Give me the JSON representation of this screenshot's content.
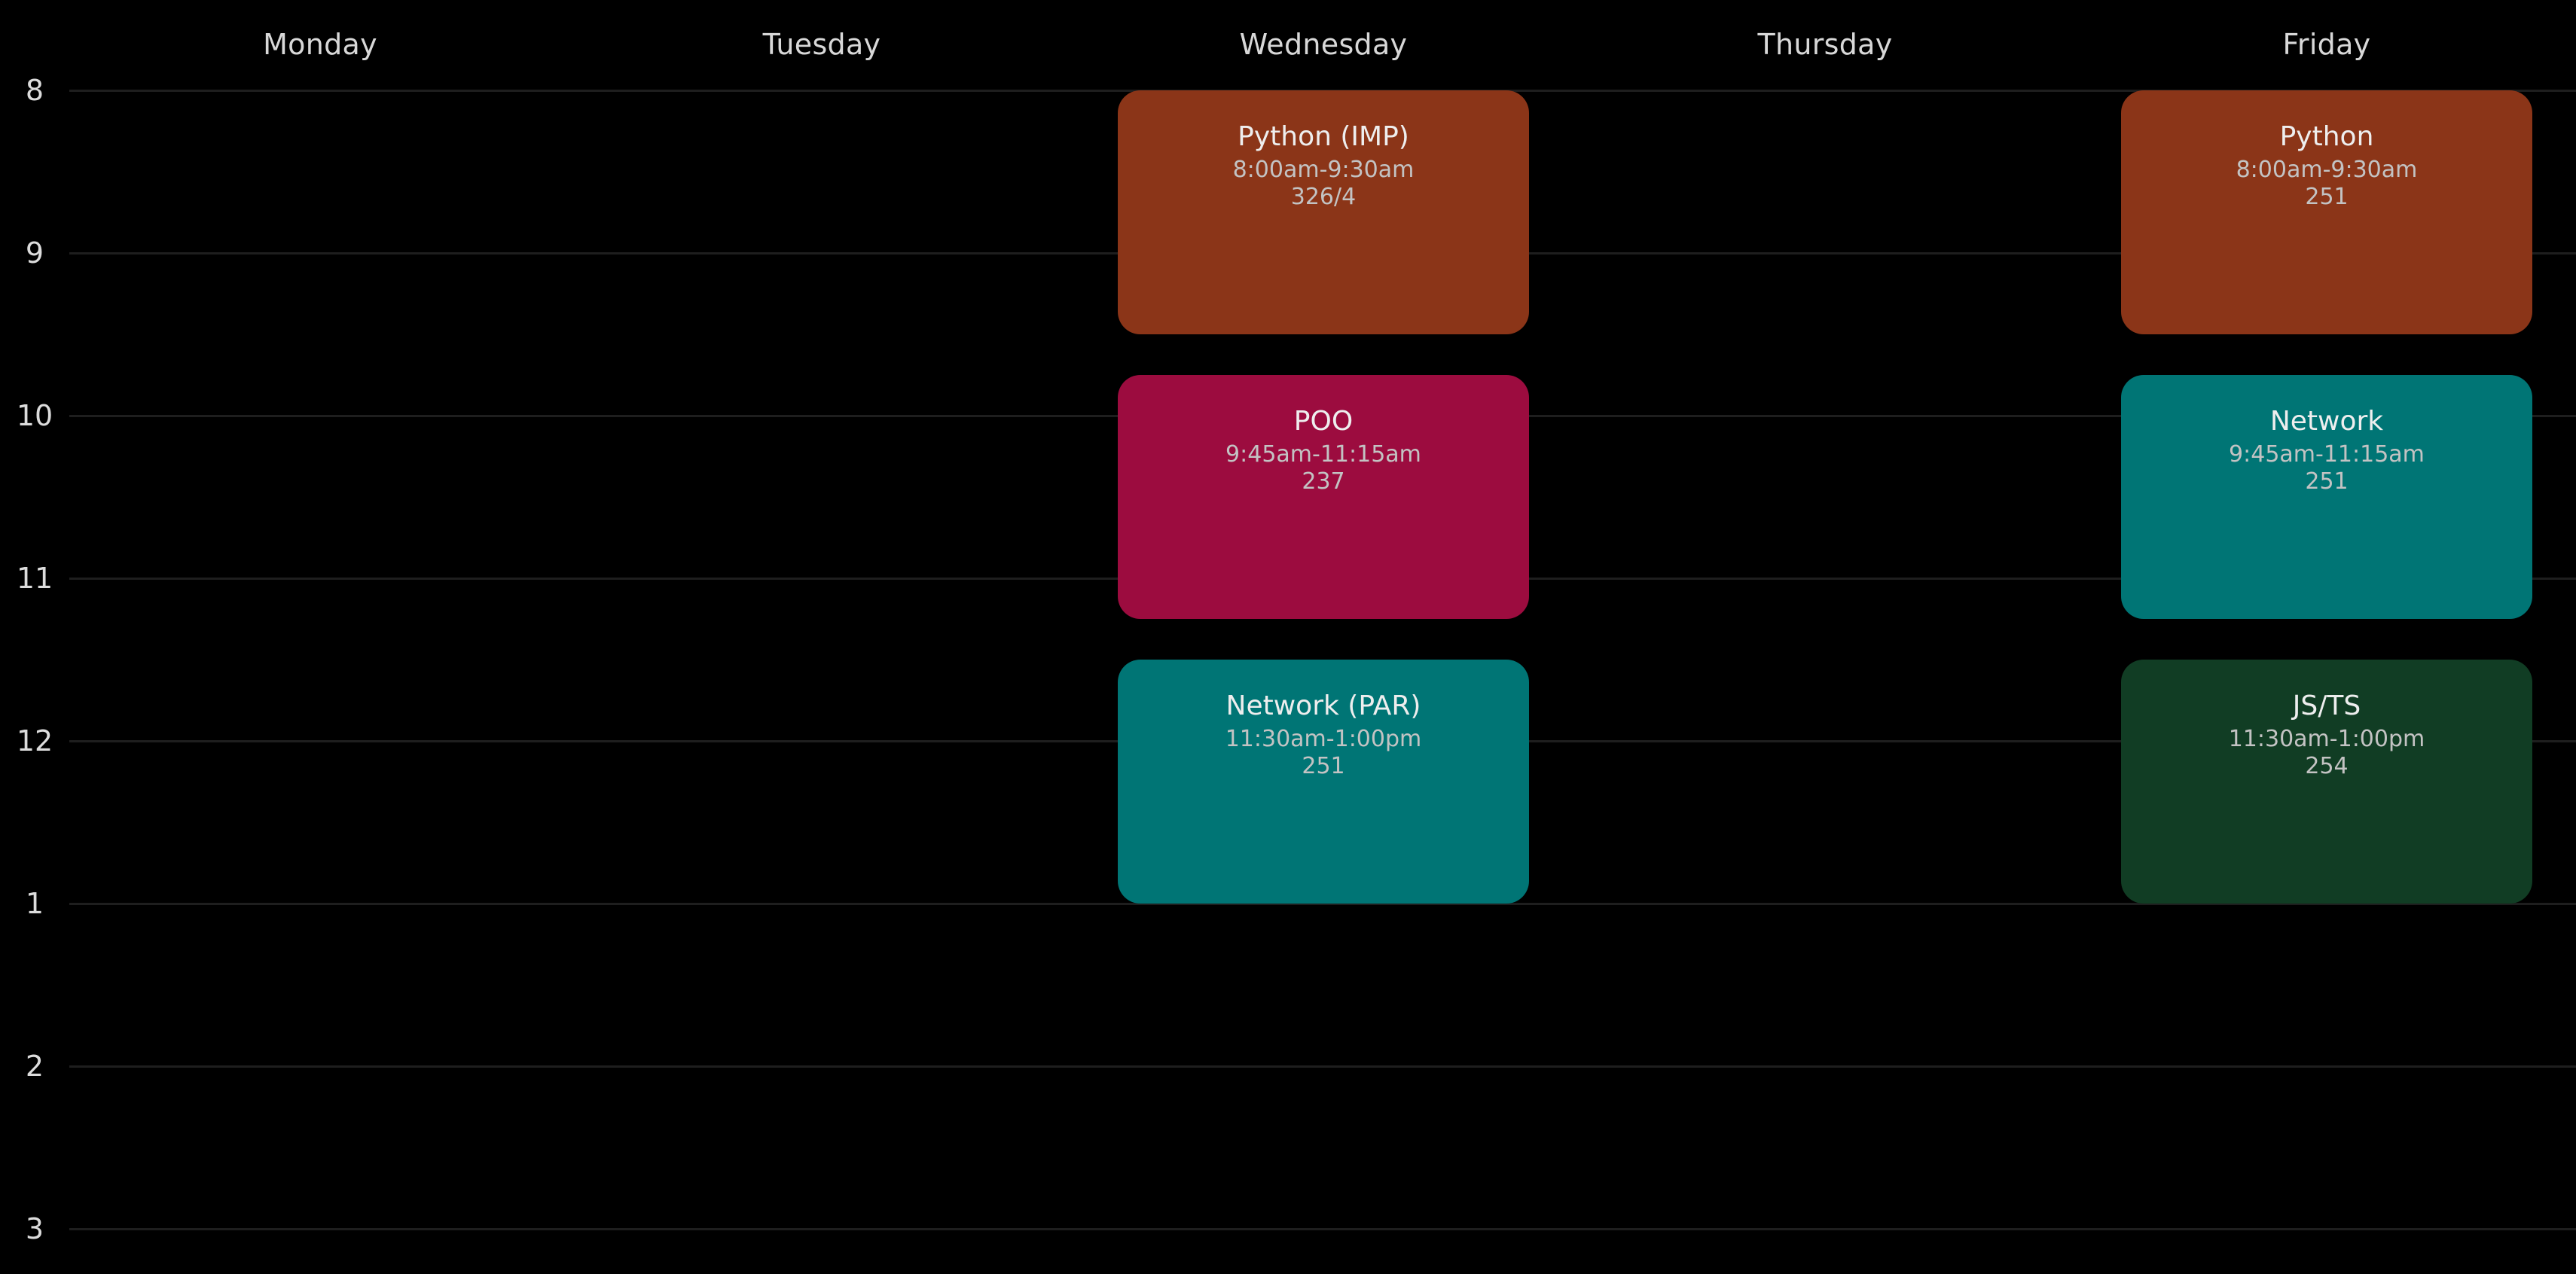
{
  "days": [
    "Monday",
    "Tuesday",
    "Wednesday",
    "Thursday",
    "Friday"
  ],
  "hours": [
    "8",
    "9",
    "10",
    "11",
    "12",
    "1",
    "2",
    "3"
  ],
  "events": [
    {
      "day": 2,
      "start": 8.0,
      "end": 9.5,
      "title": "Python (IMP)",
      "time": "8:00am-9:30am",
      "room": "326/4",
      "color": "#8b3518"
    },
    {
      "day": 2,
      "start": 9.75,
      "end": 11.25,
      "title": "POO",
      "time": "9:45am-11:15am",
      "room": "237",
      "color": "#9c0c3f"
    },
    {
      "day": 2,
      "start": 11.5,
      "end": 13.0,
      "title": "Network (PAR)",
      "time": "11:30am-1:00pm",
      "room": "251",
      "color": "#007575"
    },
    {
      "day": 4,
      "start": 8.0,
      "end": 9.5,
      "title": "Python",
      "time": "8:00am-9:30am",
      "room": "251",
      "color": "#8b3518"
    },
    {
      "day": 4,
      "start": 9.75,
      "end": 11.25,
      "title": "Network",
      "time": "9:45am-11:15am",
      "room": "251",
      "color": "#007575"
    },
    {
      "day": 4,
      "start": 11.5,
      "end": 13.0,
      "title": "JS/TS",
      "time": "11:30am-1:00pm",
      "room": "254",
      "color": "#113d24"
    }
  ]
}
